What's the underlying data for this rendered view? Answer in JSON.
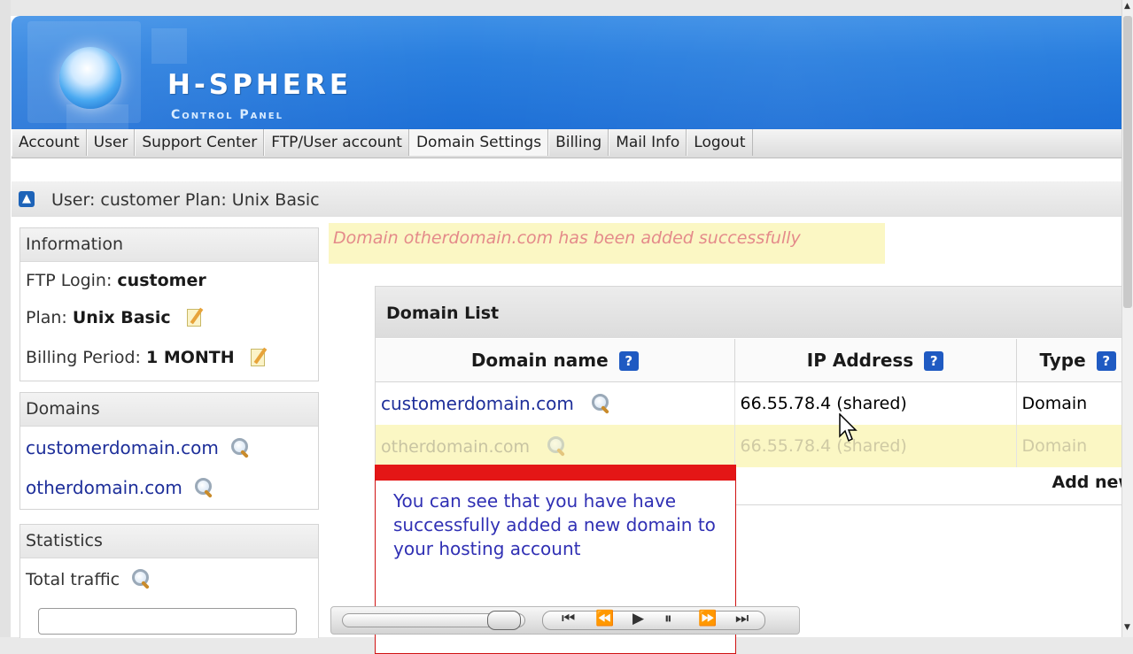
{
  "app": {
    "logo_title": "H-SPHERE",
    "logo_subtitle": "Control Panel"
  },
  "nav": {
    "items": [
      {
        "label": "Account"
      },
      {
        "label": "User"
      },
      {
        "label": "Support Center"
      },
      {
        "label": "FTP/User account"
      },
      {
        "label": "Domain Settings"
      },
      {
        "label": "Billing"
      },
      {
        "label": "Mail Info"
      },
      {
        "label": "Logout"
      }
    ]
  },
  "user_bar": {
    "text": "User: customer Plan: Unix Basic"
  },
  "information": {
    "title": "Information",
    "ftp_label": "FTP Login:",
    "ftp_value": "customer",
    "plan_label": "Plan:",
    "plan_value": "Unix Basic",
    "billing_label": "Billing Period:",
    "billing_value": "1 MONTH"
  },
  "domains_panel": {
    "title": "Domains",
    "items": [
      {
        "label": "customerdomain.com"
      },
      {
        "label": "otherdomain.com"
      }
    ]
  },
  "statistics": {
    "title": "Statistics",
    "total_traffic": "Total traffic"
  },
  "message": {
    "success": "Domain otherdomain.com has been added successfully"
  },
  "domain_list": {
    "title": "Domain List",
    "columns": [
      "Domain name",
      "IP Address",
      "Type"
    ],
    "rows": [
      {
        "domain": "customerdomain.com",
        "ip": "66.55.78.4 (shared)",
        "type": "Domain"
      },
      {
        "domain": "otherdomain.com",
        "ip": "66.55.78.4 (shared)",
        "type": "Domain"
      }
    ],
    "add_new": "Add new"
  },
  "callout": {
    "text": "You can see that you have have successfully added a new domain to your hosting account"
  },
  "icons": {
    "help": "?",
    "player_first": "⏮",
    "player_rewind": "⏪",
    "player_play": "▶",
    "player_pause": "⏸",
    "player_forward": "⏩",
    "player_last": "⏭"
  },
  "colors": {
    "banner_blue": "#2a7fdf",
    "link_blue": "#1e2f9a",
    "highlight_yellow": "#fbf7c4",
    "callout_red": "#e41616",
    "callout_text": "#3030b4",
    "success_text": "#e48a8a"
  }
}
